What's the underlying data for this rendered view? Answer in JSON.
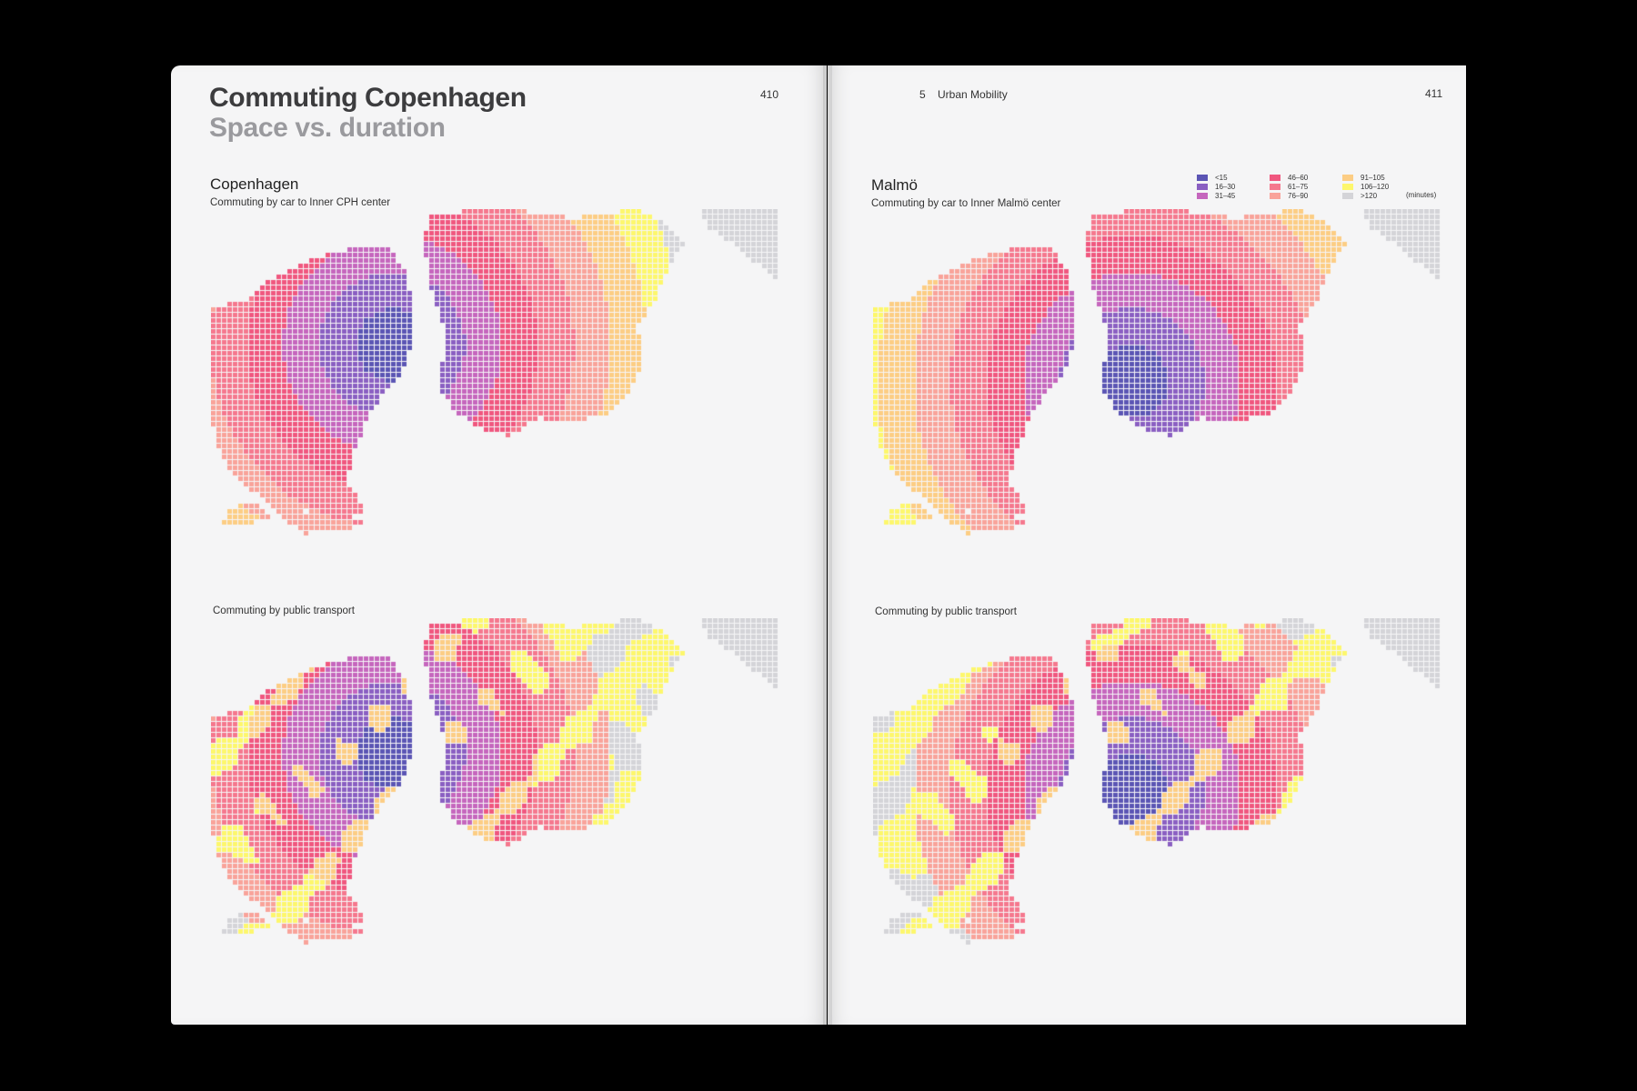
{
  "left_page": {
    "title": "Commuting Copenhagen",
    "subtitle": "Space vs. duration",
    "page_number": "410",
    "section_title": "Copenhagen",
    "car_caption": "Commuting by car to Inner CPH center",
    "transit_caption": "Commuting by public transport"
  },
  "right_page": {
    "chapter_number": "5",
    "chapter_title": "Urban Mobility",
    "page_number": "411",
    "section_title": "Malmö",
    "car_caption": "Commuting by car to Inner Malmö center",
    "transit_caption": "Commuting by public transport"
  },
  "legend": {
    "unit": "(minutes)",
    "items": [
      {
        "label": "<15",
        "color": "#5b55b4"
      },
      {
        "label": "16–30",
        "color": "#8a5fc2"
      },
      {
        "label": "31–45",
        "color": "#c566bd"
      },
      {
        "label": "46–60",
        "color": "#f0577f"
      },
      {
        "label": "61–75",
        "color": "#f5788e"
      },
      {
        "label": "76–90",
        "color": "#f9a39a"
      },
      {
        "label": "91–105",
        "color": "#fccd84"
      },
      {
        "label": "106–120",
        "color": "#fdf76c"
      },
      {
        "label": ">120",
        "color": "#d4d4d8"
      }
    ]
  }
}
